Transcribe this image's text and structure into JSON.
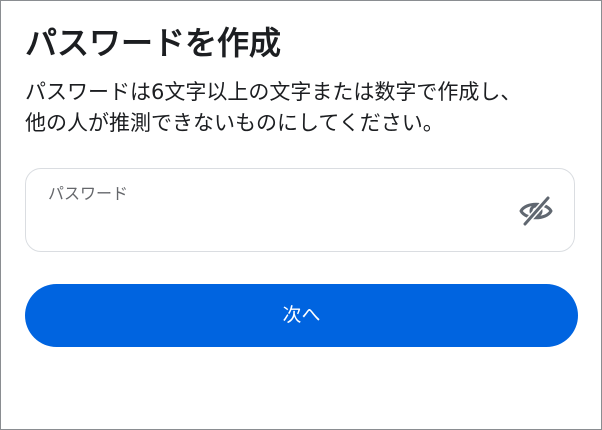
{
  "page": {
    "title": "パスワードを作成",
    "description_lines": [
      "パスワードは6文字以上の文字または数字で作成し、",
      "他の人が推測できないものにしてください。"
    ]
  },
  "password_field": {
    "label": "パスワード",
    "value": "",
    "toggle_icon": "eye-slash-icon"
  },
  "next_button": {
    "label": "次へ"
  },
  "colors": {
    "primary": "#0064e0",
    "text": "#1c1e21",
    "muted": "#65676b",
    "field_border": "#dadde1",
    "icon": "#606770"
  }
}
